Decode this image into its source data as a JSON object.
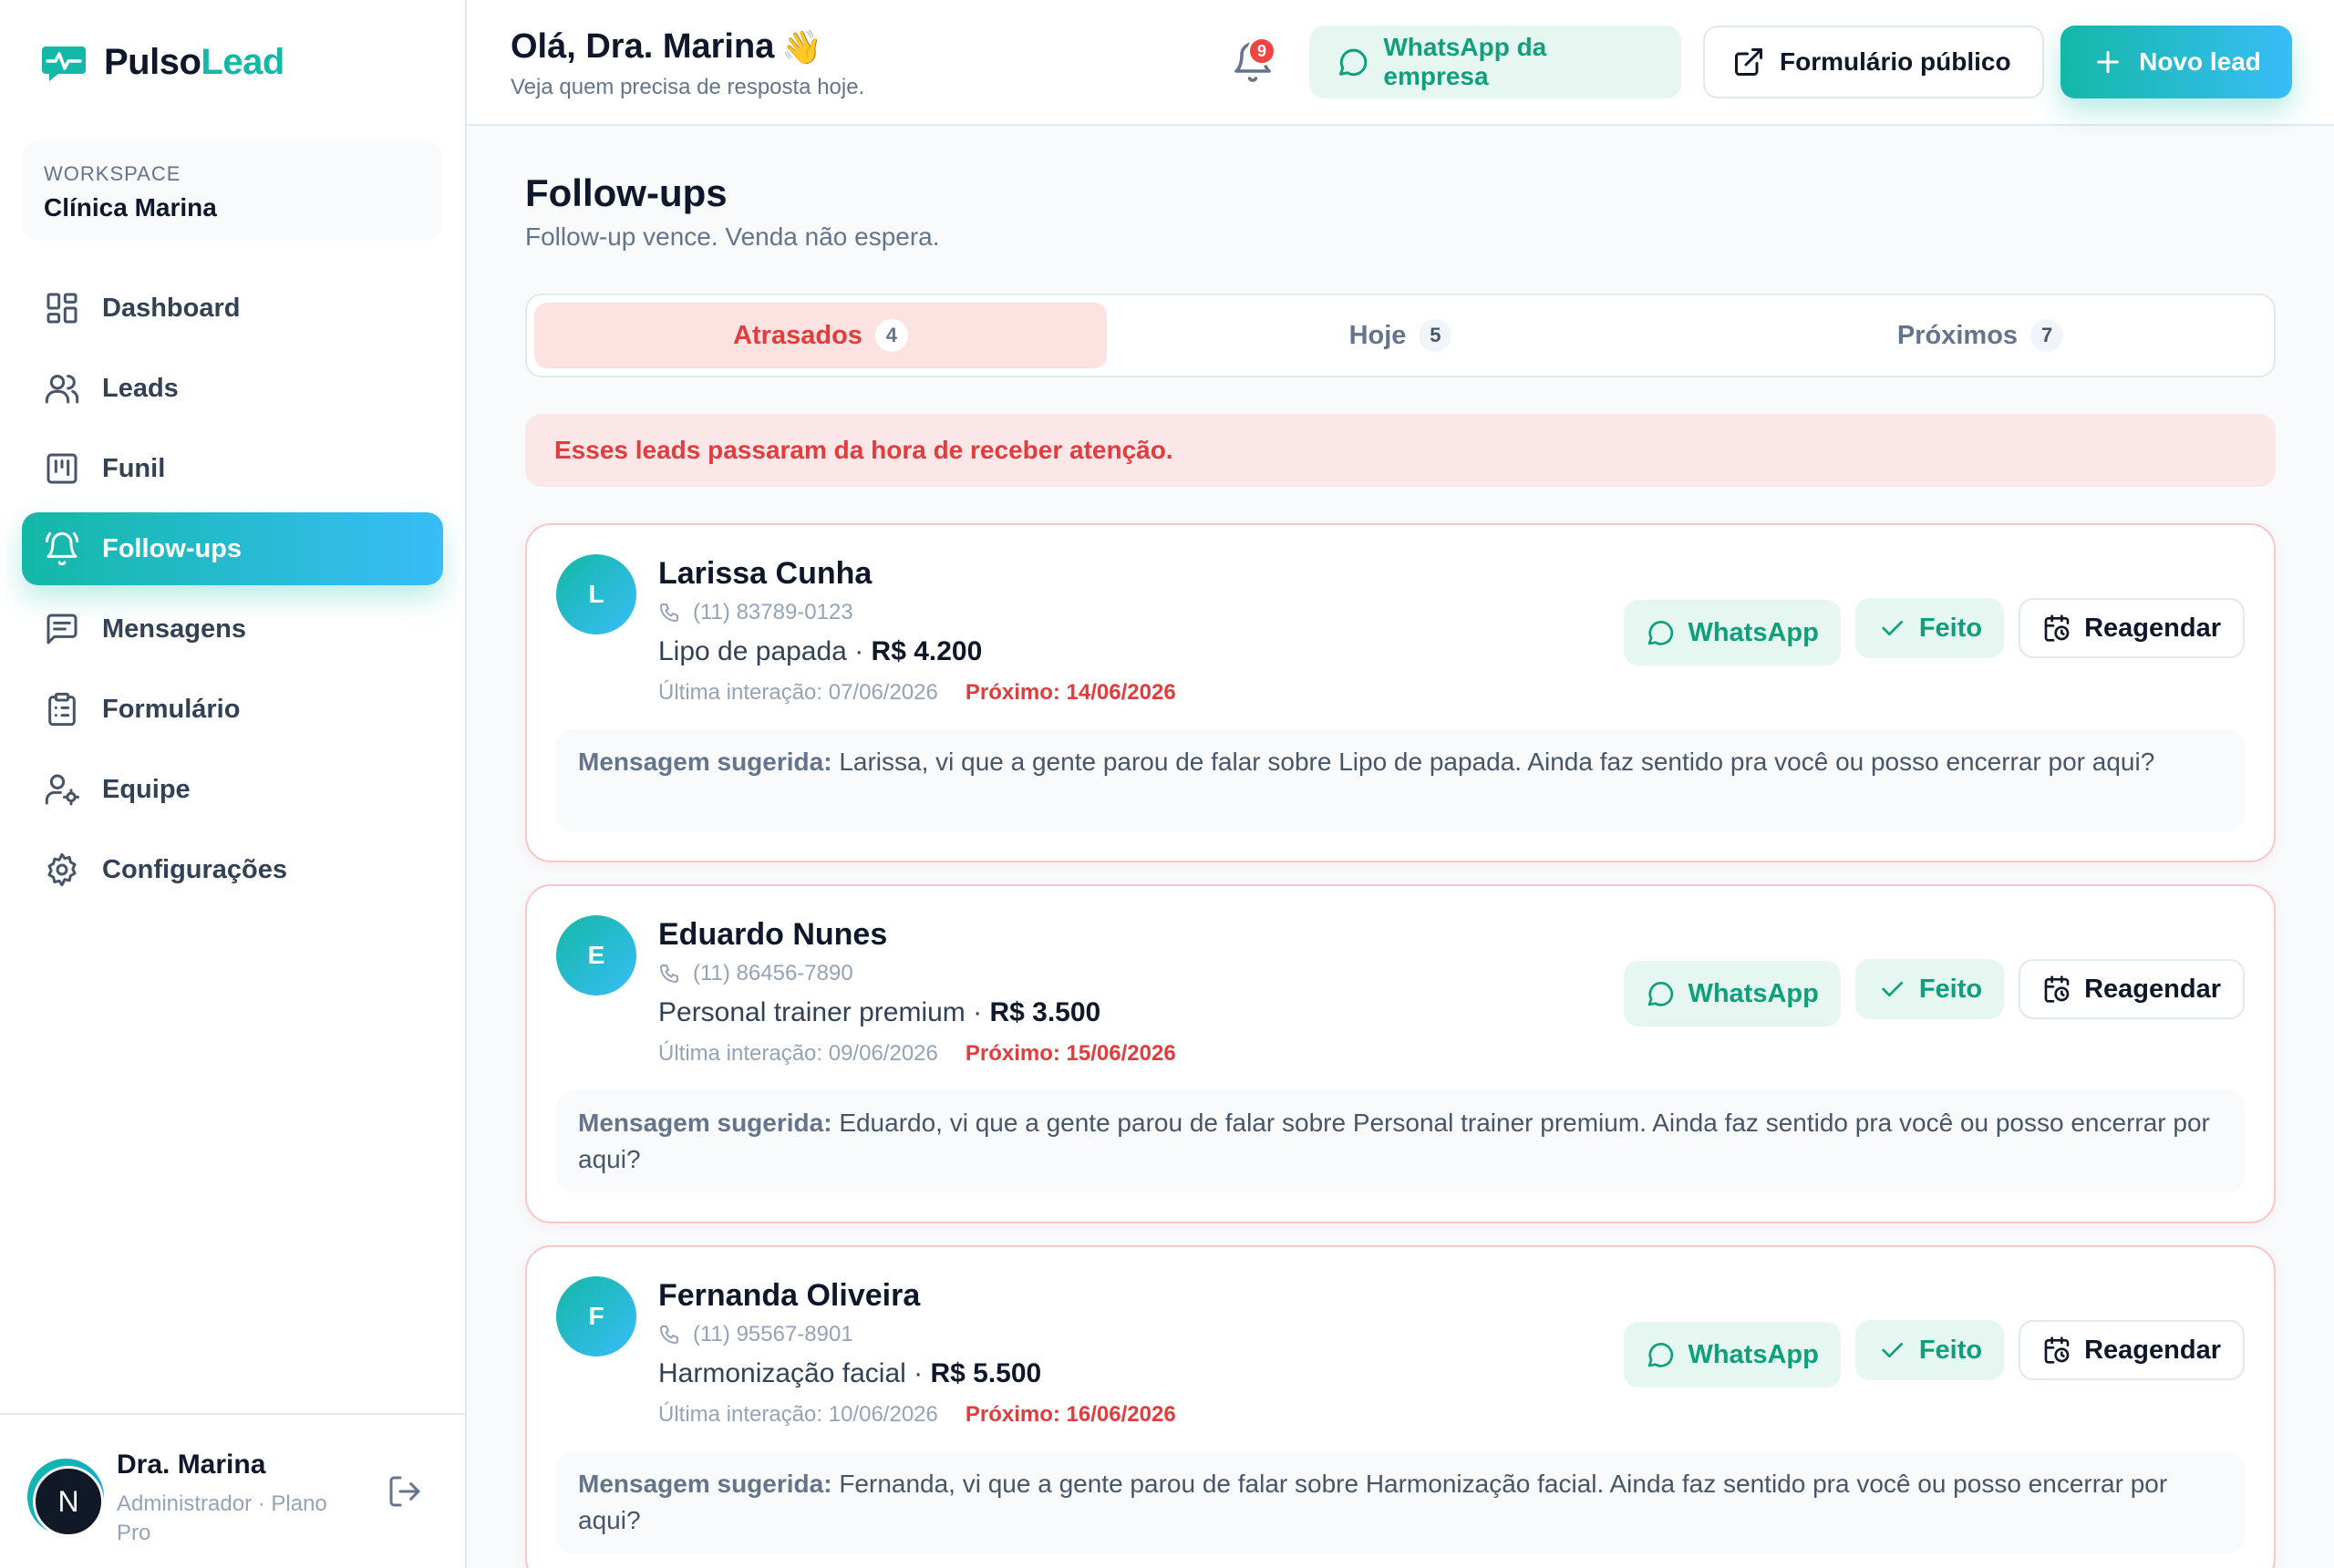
{
  "brand": {
    "name_part1": "Pulso",
    "name_part2": "Lead",
    "accent": "#14b8a6",
    "accent2": "#38bdf8"
  },
  "workspace": {
    "label": "WORKSPACE",
    "name": "Clínica Marina"
  },
  "nav": {
    "items": [
      {
        "label": "Dashboard",
        "icon": "dashboard-grid-icon"
      },
      {
        "label": "Leads",
        "icon": "users-icon"
      },
      {
        "label": "Funil",
        "icon": "kanban-icon"
      },
      {
        "label": "Follow-ups",
        "icon": "bell-ring-icon",
        "active": true
      },
      {
        "label": "Mensagens",
        "icon": "message-square-icon"
      },
      {
        "label": "Formulário",
        "icon": "clipboard-list-icon"
      },
      {
        "label": "Equipe",
        "icon": "user-cog-icon"
      },
      {
        "label": "Configurações",
        "icon": "gear-icon"
      }
    ]
  },
  "user": {
    "initial": "N",
    "name": "Dra. Marina",
    "role": "Administrador · Plano Pro"
  },
  "header": {
    "greeting": "Olá, Dra. Marina",
    "wave": "👋",
    "subtitle": "Veja quem precisa de resposta hoje.",
    "notifications": "9",
    "whatsapp_label": "WhatsApp da empresa",
    "form_label": "Formulário público",
    "new_lead_label": "Novo lead"
  },
  "page": {
    "title": "Follow-ups",
    "subtitle": "Follow-up vence. Venda não espera.",
    "alert": "Esses leads passaram da hora de receber atenção."
  },
  "tabs": [
    {
      "label": "Atrasados",
      "count": "4",
      "active": true
    },
    {
      "label": "Hoje",
      "count": "5"
    },
    {
      "label": "Próximos",
      "count": "7"
    }
  ],
  "actions": {
    "whatsapp": "WhatsApp",
    "done": "Feito",
    "reschedule": "Reagendar"
  },
  "leads": [
    {
      "initial": "L",
      "name": "Larissa Cunha",
      "phone": "(11) 83789-0123",
      "service": "Lipo de papada",
      "value": "R$ 4.200",
      "last": "Última interação: 07/06/2026",
      "next": "Próximo: 14/06/2026",
      "suggest_label": "Mensagem sugerida:",
      "suggest_text": "Larissa, vi que a gente parou de falar sobre Lipo de papada. Ainda faz sentido pra você ou posso encerrar por aqui?"
    },
    {
      "initial": "E",
      "name": "Eduardo Nunes",
      "phone": "(11) 86456-7890",
      "service": "Personal trainer premium",
      "value": "R$ 3.500",
      "last": "Última interação: 09/06/2026",
      "next": "Próximo: 15/06/2026",
      "suggest_label": "Mensagem sugerida:",
      "suggest_text": "Eduardo, vi que a gente parou de falar sobre Personal trainer premium. Ainda faz sentido pra você ou posso encerrar por aqui?"
    },
    {
      "initial": "F",
      "name": "Fernanda Oliveira",
      "phone": "(11) 95567-8901",
      "service": "Harmonização facial",
      "value": "R$ 5.500",
      "last": "Última interação: 10/06/2026",
      "next": "Próximo: 16/06/2026",
      "suggest_label": "Mensagem sugerida:",
      "suggest_text": "Fernanda, vi que a gente parou de falar sobre Harmonização facial. Ainda faz sentido pra você ou posso encerrar por aqui?"
    }
  ]
}
